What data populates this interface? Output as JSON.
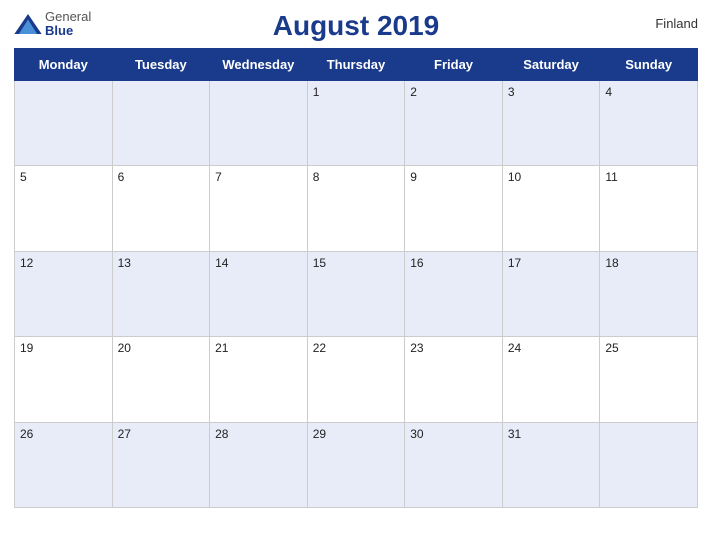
{
  "header": {
    "logo_general": "General",
    "logo_blue": "Blue",
    "title": "August 2019",
    "country": "Finland"
  },
  "weekdays": [
    "Monday",
    "Tuesday",
    "Wednesday",
    "Thursday",
    "Friday",
    "Saturday",
    "Sunday"
  ],
  "weeks": [
    [
      null,
      null,
      null,
      1,
      2,
      3,
      4
    ],
    [
      5,
      6,
      7,
      8,
      9,
      10,
      11
    ],
    [
      12,
      13,
      14,
      15,
      16,
      17,
      18
    ],
    [
      19,
      20,
      21,
      22,
      23,
      24,
      25
    ],
    [
      26,
      27,
      28,
      29,
      30,
      31,
      null
    ]
  ]
}
